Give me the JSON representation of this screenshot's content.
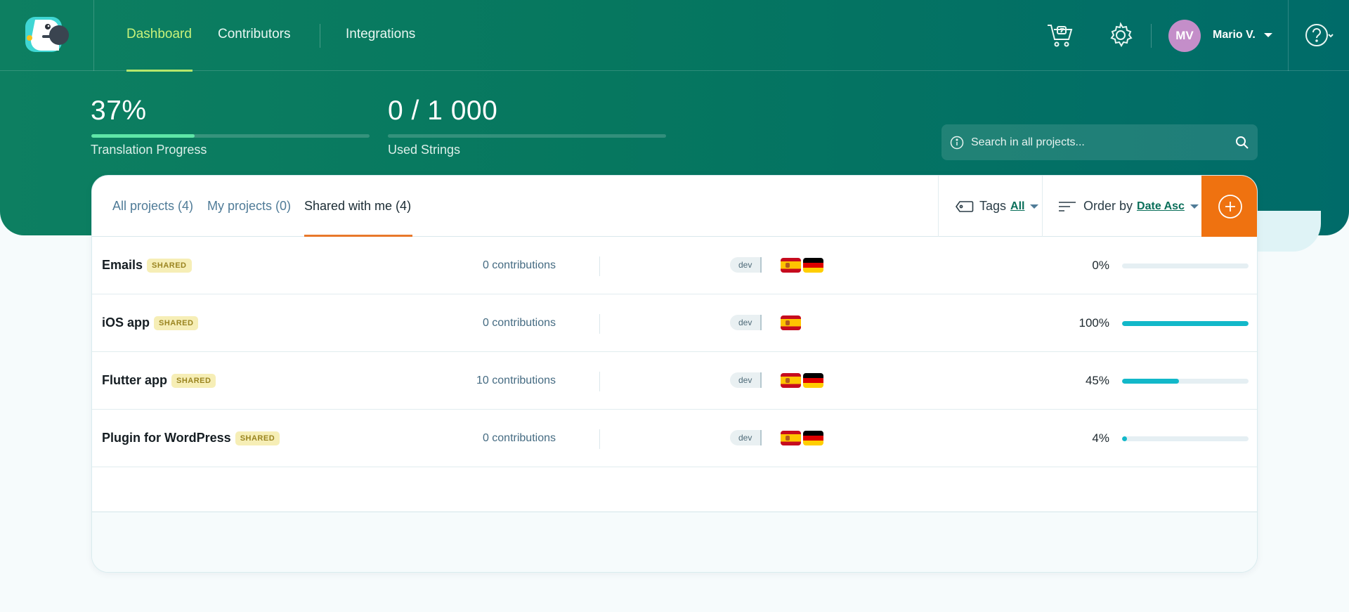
{
  "nav": {
    "links": [
      {
        "label": "Dashboard",
        "active": true
      },
      {
        "label": "Contributors",
        "active": false
      },
      {
        "label": "Integrations",
        "active": false
      }
    ],
    "icons": {
      "cart": "shopping-cart-icon",
      "settings": "gear-icon",
      "help": "help-icon"
    },
    "user": {
      "initials": "MV",
      "name": "Mario V."
    }
  },
  "stats": [
    {
      "value": "37%",
      "label": "Translation Progress",
      "fill": 0.37
    },
    {
      "value": "0 / 1 000",
      "label": "Used Strings",
      "fill": 0
    }
  ],
  "search": {
    "placeholder": "Search in all projects..."
  },
  "tabs": [
    {
      "label": "All projects (4)",
      "active": false
    },
    {
      "label": "My projects (0)",
      "active": false
    },
    {
      "label": "Shared with me (4)",
      "active": true
    }
  ],
  "toolbar": {
    "tags_label": "Tags",
    "tags_value": "All",
    "order_label": "Order by",
    "order_value": "Date Asc"
  },
  "projects": [
    {
      "name": "Emails",
      "badge": "SHARED",
      "contributions": "0 contributions",
      "env": "dev",
      "flags": [
        "es",
        "de"
      ],
      "percent": "0%",
      "progress": 0
    },
    {
      "name": "iOS app",
      "badge": "SHARED",
      "contributions": "0 contributions",
      "env": "dev",
      "flags": [
        "es"
      ],
      "percent": "100%",
      "progress": 1.0
    },
    {
      "name": "Flutter app",
      "badge": "SHARED",
      "contributions": "10 contributions",
      "env": "dev",
      "flags": [
        "es",
        "de"
      ],
      "percent": "45%",
      "progress": 0.45
    },
    {
      "name": "Plugin for WordPress",
      "badge": "SHARED",
      "contributions": "0 contributions",
      "env": "dev",
      "flags": [
        "es",
        "de"
      ],
      "percent": "4%",
      "progress": 0.04
    }
  ],
  "colors": {
    "accent": "#ef7210",
    "progress": "#12b8c9",
    "header": "#0a7a60",
    "nav_active": "#c8f27a"
  }
}
